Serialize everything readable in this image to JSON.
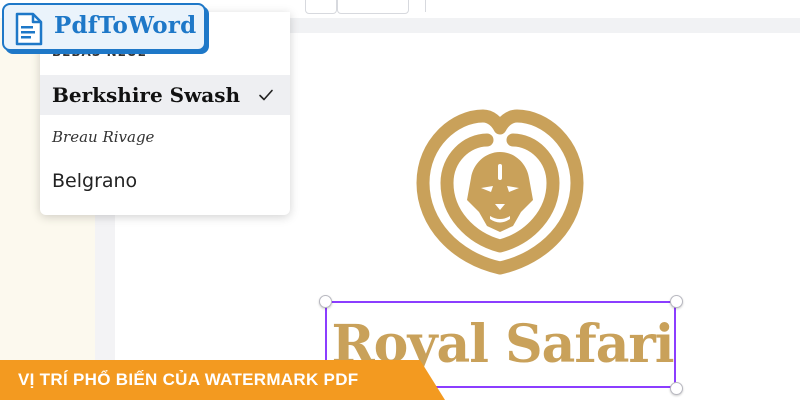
{
  "brand": {
    "name": "PdfToWord",
    "icon": "document-icon",
    "color": "#1e78c8"
  },
  "font_menu": {
    "items": [
      {
        "label": "BEBAS NEUE",
        "state": "partially-visible"
      },
      {
        "label": "Berkshire Swash",
        "selected": true
      },
      {
        "label": "Breau Rivage"
      },
      {
        "label": "Belgrano"
      }
    ],
    "selected_icon": "check-icon"
  },
  "canvas": {
    "logo_icon": "lion-head-icon",
    "logo_color": "#c9a15a",
    "text": "Royal Safari",
    "selection_color": "#8b3dff"
  },
  "banner": {
    "text": "VỊ TRÍ PHỔ BIẾN CỦA WATERMARK PDF",
    "color": "#f39a20"
  }
}
